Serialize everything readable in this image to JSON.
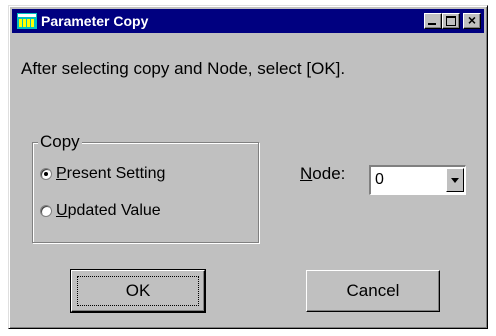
{
  "window": {
    "title": "Parameter Copy",
    "close_glyph": "×"
  },
  "instruction": "After selecting copy and Node, select [OK].",
  "copy_group": {
    "label": "Copy",
    "options": [
      {
        "underlined": "P",
        "rest": "resent Setting",
        "selected": true
      },
      {
        "underlined": "U",
        "rest": "pdated Value",
        "selected": false
      }
    ]
  },
  "node": {
    "underlined": "N",
    "rest": "ode:",
    "value": "0"
  },
  "buttons": {
    "ok": "OK",
    "cancel": "Cancel"
  }
}
